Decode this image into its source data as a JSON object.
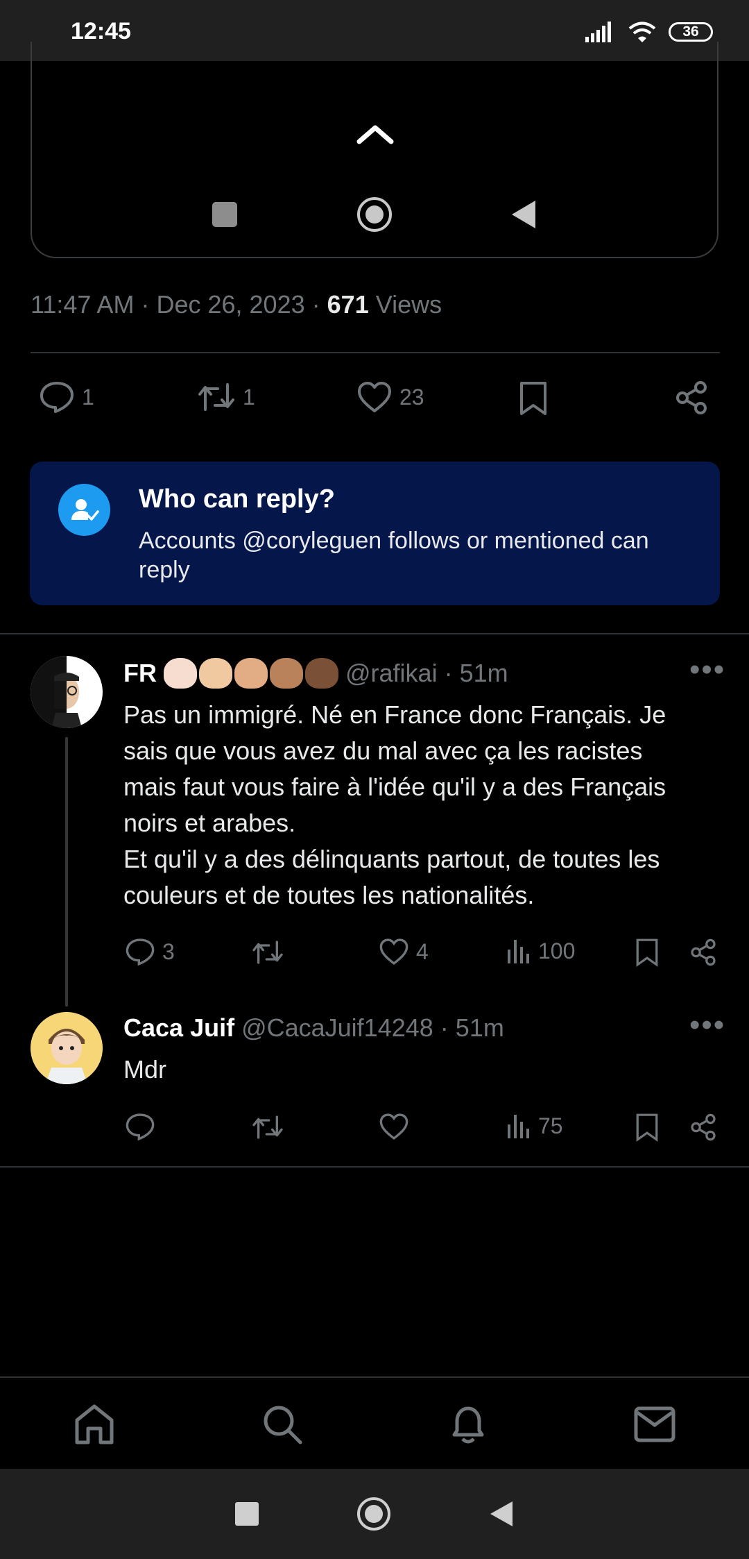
{
  "status_bar": {
    "time": "12:45",
    "battery": "36"
  },
  "focused_tweet": {
    "time": "11:47 AM",
    "date": "Dec 26, 2023",
    "views_count": "671",
    "views_label": "Views",
    "replies": "1",
    "retweets": "1",
    "likes": "23"
  },
  "who_can_reply": {
    "title": "Who can reply?",
    "text": "Accounts @coryleguen follows or mentioned can reply"
  },
  "replies": [
    {
      "name": "FR",
      "handle": "@rafikai",
      "time": "51m",
      "text_lines": [
        "Pas un immigré. Né en France donc Français. Je",
        "sais que vous avez du mal avec ça les racistes",
        "mais faut vous faire à l'idée qu'il y a des Français",
        "noirs et arabes.",
        "Et qu'il y a des délinquants partout, de toutes les",
        "couleurs et de toutes les nationalités."
      ],
      "reply_count": "3",
      "like_count": "4",
      "view_count": "100",
      "emoji_skin_colors": [
        "#f7dcd0",
        "#f1c9a0",
        "#e2ad84",
        "#b9825a",
        "#7a5037"
      ]
    },
    {
      "name": "Caca Juif",
      "handle": "@CacaJuif14248",
      "time": "51m",
      "text": "Mdr",
      "view_count": "75"
    }
  ],
  "separator": "·",
  "colors": {
    "accent": "#1d9bf0",
    "muted": "#71767b",
    "banner": "#05164a"
  },
  "icons": [
    "chevron-up-icon",
    "square-icon",
    "circle-icon",
    "back-triangle-icon",
    "reply-icon",
    "retweet-icon",
    "heart-icon",
    "bookmark-icon",
    "share-icon",
    "views-icon",
    "person-check-icon",
    "home-icon",
    "search-icon",
    "bell-icon",
    "mail-icon",
    "more-icon"
  ]
}
